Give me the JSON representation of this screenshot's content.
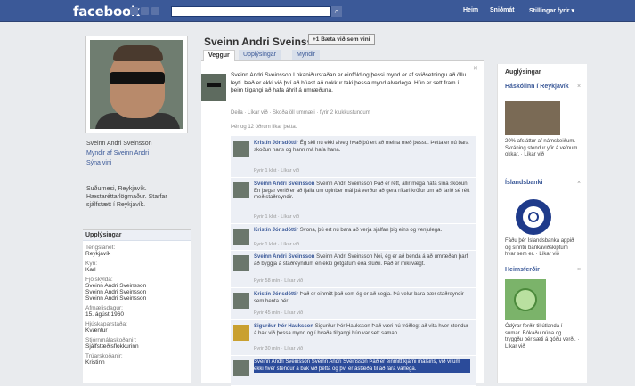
{
  "topbar": {
    "logo": "facebook",
    "search_placeholder": "",
    "links": [
      "Heim",
      "Sniðmát",
      "Stillingar fyrir ▾"
    ]
  },
  "sidebar": {
    "friends_line": "Sveinn Andri Sveinsson",
    "photos_link": "Myndir af Sveinn Andri",
    "edit_link": "Sýna vini",
    "bio": "Suðurnesi, Reykjavík. Hæstaréttarlögmaður. Starfar sjálfstætt í Reykjavík.",
    "info_header": "Upplýsingar",
    "info": [
      {
        "label": "Tengslanet:",
        "value": "Reykjavík"
      },
      {
        "label": "Kyn:",
        "value": "Karl"
      },
      {
        "label": "Fjölskylda:",
        "value": "Sveinn Andri Sveinsson\nSveinn Andri Sveinsson\nSveinn Andri Sveinsson"
      },
      {
        "label": "Afmælisdagur:",
        "value": "15. ágúst 1960"
      },
      {
        "label": "Hjúskaparstaða:",
        "value": "Kvæntur"
      },
      {
        "label": "Stjórnmálaskoðanir:",
        "value": "Sjálfstæðisflokkurinn"
      },
      {
        "label": "Trúarskoðanir:",
        "value": "Kristinn"
      }
    ]
  },
  "profile": {
    "name": "Sveinn Andri Sveinsson",
    "add_friend": "+1 Bæta við sem vini",
    "tabs": [
      "Veggur",
      "Upplýsingar",
      "Myndir"
    ]
  },
  "post": {
    "author": "Sveinn Andri Sveinsson",
    "text": "Sveinn Andri Sveinsson Lokaniðurstaðan er einföld og þessi mynd er af sviðsetningu að öllu leyti. Það er ekki við því að búast að nokkur taki þessa mynd alvarlega. Hún er sett fram í þeim tilgangi að hafa áhrif á umræðuna.",
    "meta": "Deila · Líkar við · Skoða öll ummæli · fyrir 2 klukkustundum",
    "like_line": "Þér og 12 öðrum líkar þetta."
  },
  "comments": [
    {
      "author": "Kristín Jónsdóttir",
      "text": "Ég skil nú ekki alveg hvað þú ert að meina með þessu. Þetta er nú bara skoðun hans og hann má hafa hana.",
      "time": "Fyrir 1 klst · Líkar við"
    },
    {
      "author": "Sveinn Andri Sveinsson",
      "text": "Sveinn Andri Sveinsson Það er rétt, allir mega hafa sína skoðun. En þegar verið er að fjalla um opinber mál þá verður að gera ríkari kröfur um að farið sé rétt með staðreyndir.",
      "time": "Fyrir 1 klst · Líkar við"
    },
    {
      "author": "Kristín Jónsdóttir",
      "text": "Svona, þú ert nú bara að verja sjálfan þig eins og venjulega.",
      "time": "Fyrir 1 klst · Líkar við"
    },
    {
      "author": "Sveinn Andri Sveinsson",
      "text": "Sveinn Andri Sveinsson Nei, ég er að benda á að umræðan þarf að byggja á staðreyndum en ekki getgátum eða slúðri. Það er mikilvægt.",
      "time": "Fyrir 58 mín · Líkar við"
    },
    {
      "author": "Kristín Jónsdóttir",
      "text": "Það er einmitt það sem ég er að segja. Þú velur bara þær staðreyndir sem henta þér.",
      "time": "Fyrir 45 mín · Líkar við"
    },
    {
      "author": "Sigurður Þór Hauksson",
      "text": "Sigurður Þór Hauksson Það væri nú fróðlegt að vita hver stendur á bak við þessa mynd og í hvaða tilgangi hún var sett saman.",
      "time": "Fyrir 30 mín · Líkar við"
    },
    {
      "author": "Sveinn Andri Sveinsson",
      "text": "Sveinn Andri Sveinsson Það er einmitt kjarni málsins, við vitum ekki hver stendur á bak við þetta og því er ástæða til að fara varlega.",
      "time": "Fyrir 12 mín · Líkar við"
    }
  ],
  "right": {
    "header": "Auglýsingar",
    "ads": [
      {
        "title": "Háskólinn í Reykjavík",
        "sub": "",
        "text": "20% afsláttur af námskeiðum. Skráning stendur yfir á vefnum okkar. · Líkar við"
      },
      {
        "title": "Íslandsbanki",
        "sub": "",
        "text": "Fáðu þér Íslandsbanka appið og sinntu bankaviðskiptum hvar sem er. · Líkar við"
      },
      {
        "title": "Heimsferðir",
        "sub": "",
        "text": "Ódýrar ferðir til útlanda í sumar. Bókaðu núna og tryggðu þér sæti á góðu verði. · Líkar við"
      }
    ]
  }
}
